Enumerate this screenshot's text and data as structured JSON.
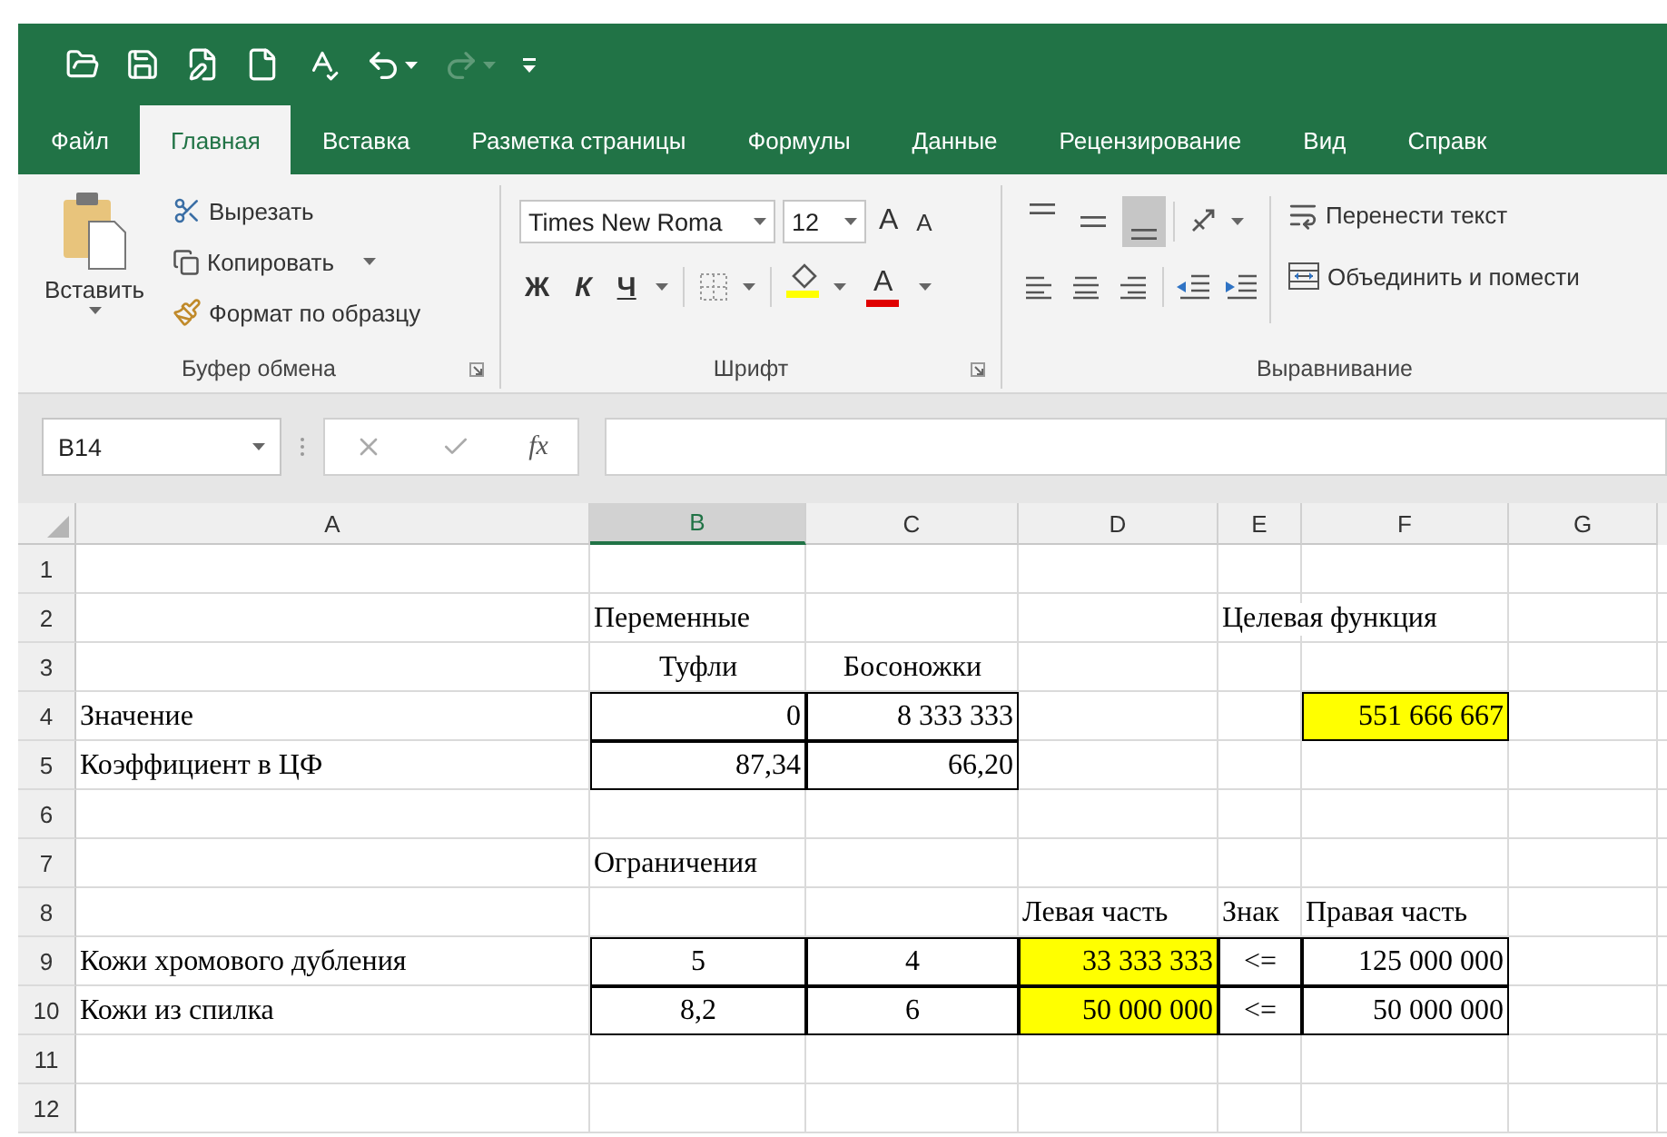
{
  "quick_access": {
    "redo_disabled": true
  },
  "tabs": [
    {
      "label": "Файл",
      "selected": false
    },
    {
      "label": "Главная",
      "selected": true
    },
    {
      "label": "Вставка",
      "selected": false
    },
    {
      "label": "Разметка страницы",
      "selected": false
    },
    {
      "label": "Формулы",
      "selected": false
    },
    {
      "label": "Данные",
      "selected": false
    },
    {
      "label": "Рецензирование",
      "selected": false
    },
    {
      "label": "Вид",
      "selected": false
    },
    {
      "label": "Справк",
      "selected": false
    }
  ],
  "ribbon": {
    "clipboard": {
      "paste": "Вставить",
      "cut": "Вырезать",
      "copy": "Копировать",
      "format_painter": "Формат по образцу",
      "label": "Буфер обмена"
    },
    "font": {
      "font_name": "Times New Roma",
      "font_size": "12",
      "grow": "A",
      "shrink": "A",
      "bold": "Ж",
      "italic": "К",
      "underline": "Ч",
      "font_color": "A",
      "label": "Шрифт"
    },
    "alignment": {
      "vertical": [
        {
          "kind": "top",
          "selected": false
        },
        {
          "kind": "middle",
          "selected": false
        },
        {
          "kind": "bottom",
          "selected": true
        }
      ],
      "wrap_text": "Перенести текст",
      "merge": "Объединить и помести",
      "label": "Выравнивание"
    }
  },
  "formula_bar": {
    "name_box": "B14",
    "function_label": "fx"
  },
  "sheet": {
    "columns": [
      {
        "label": "A",
        "selected": false
      },
      {
        "label": "B",
        "selected": true
      },
      {
        "label": "C",
        "selected": false
      },
      {
        "label": "D",
        "selected": false
      },
      {
        "label": "E",
        "selected": false
      },
      {
        "label": "F",
        "selected": false
      },
      {
        "label": "G",
        "selected": false
      }
    ],
    "rows": [
      {
        "number": "1"
      },
      {
        "number": "2",
        "cells": [
          {},
          {
            "text": "Переменные"
          },
          {},
          {},
          {
            "text": "Целевая функция"
          },
          {},
          {}
        ]
      },
      {
        "number": "3",
        "cells": [
          {},
          {
            "text": "Туфли",
            "centered": true
          },
          {
            "text": "Босоножки",
            "centered": true
          },
          {},
          {},
          {},
          {}
        ]
      },
      {
        "number": "4",
        "cells": [
          {
            "text": "Значение"
          },
          {
            "text": "0",
            "right_aligned": true,
            "boxed": true
          },
          {
            "text": "8 333 333",
            "right_aligned": true,
            "boxed": true
          },
          {},
          {},
          {
            "text": "551 666 667",
            "right_aligned": true,
            "boxed": true,
            "highlighted": true
          },
          {}
        ]
      },
      {
        "number": "5",
        "cells": [
          {
            "text": "Коэффициент в ЦФ"
          },
          {
            "text": "87,34",
            "right_aligned": true,
            "boxed": true
          },
          {
            "text": "66,20",
            "right_aligned": true,
            "boxed": true
          },
          {},
          {},
          {},
          {}
        ]
      },
      {
        "number": "6"
      },
      {
        "number": "7",
        "cells": [
          {},
          {
            "text": "Ограничения"
          },
          {},
          {},
          {},
          {},
          {}
        ]
      },
      {
        "number": "8",
        "cells": [
          {},
          {},
          {},
          {
            "text": "Левая часть"
          },
          {
            "text": "Знак"
          },
          {
            "text": "Правая часть"
          },
          {}
        ]
      },
      {
        "number": "9",
        "cells": [
          {
            "text": "Кожи хромового дубления"
          },
          {
            "text": "5",
            "centered": true,
            "boxed": true
          },
          {
            "text": "4",
            "centered": true,
            "boxed": true
          },
          {
            "text": "33 333 333",
            "right_aligned": true,
            "boxed": true,
            "highlighted": true
          },
          {
            "text": "<=",
            "centered": true,
            "boxed": true
          },
          {
            "text": "125 000 000",
            "right_aligned": true,
            "boxed": true
          },
          {}
        ]
      },
      {
        "number": "10",
        "cells": [
          {
            "text": "Кожи из спилка"
          },
          {
            "text": "8,2",
            "centered": true,
            "boxed": true
          },
          {
            "text": "6",
            "centered": true,
            "boxed": true
          },
          {
            "text": "50 000 000",
            "right_aligned": true,
            "boxed": true,
            "highlighted": true
          },
          {
            "text": "<=",
            "centered": true,
            "boxed": true
          },
          {
            "text": "50 000 000",
            "right_aligned": true,
            "boxed": true
          },
          {}
        ]
      },
      {
        "number": "11"
      },
      {
        "number": "12"
      }
    ]
  }
}
